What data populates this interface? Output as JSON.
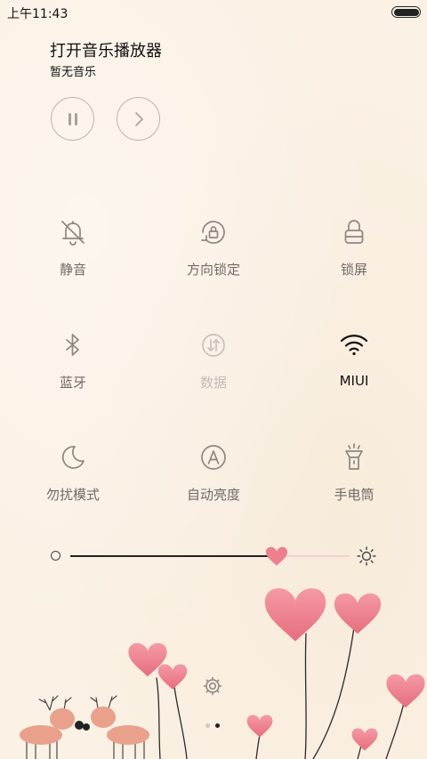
{
  "status_bar": {
    "time": "上午11:43",
    "battery_level": 1.0
  },
  "music": {
    "title": "打开音乐播放器",
    "subtitle": "暂无音乐",
    "pause_icon": "pause-icon",
    "next_icon": "chevron-right-icon"
  },
  "toggles": [
    {
      "label": "静音",
      "icon": "bell-off-icon",
      "state": "off"
    },
    {
      "label": "方向锁定",
      "icon": "rotation-lock-icon",
      "state": "off"
    },
    {
      "label": "锁屏",
      "icon": "lock-icon",
      "state": "off"
    },
    {
      "label": "蓝牙",
      "icon": "bluetooth-icon",
      "state": "off"
    },
    {
      "label": "数据",
      "icon": "mobile-data-icon",
      "state": "disabled"
    },
    {
      "label": "MIUI",
      "icon": "wifi-icon",
      "state": "on"
    },
    {
      "label": "勿扰模式",
      "icon": "moon-icon",
      "state": "off"
    },
    {
      "label": "自动亮度",
      "icon": "auto-brightness-icon",
      "state": "off"
    },
    {
      "label": "手电筒",
      "icon": "flashlight-icon",
      "state": "off"
    }
  ],
  "brightness": {
    "level": 0.74,
    "low_icon": "brightness-low-icon",
    "high_icon": "brightness-high-icon"
  },
  "settings": {
    "icon": "gear-icon"
  },
  "pager": {
    "count": 2,
    "current": 2
  },
  "colors": {
    "background": "#fbf1e4",
    "toggle_off": "#6f6a66",
    "toggle_disabled": "#c3bcb6",
    "toggle_on": "#111111",
    "heart": "#ee8290",
    "slider_track": "#f2d0d3"
  }
}
